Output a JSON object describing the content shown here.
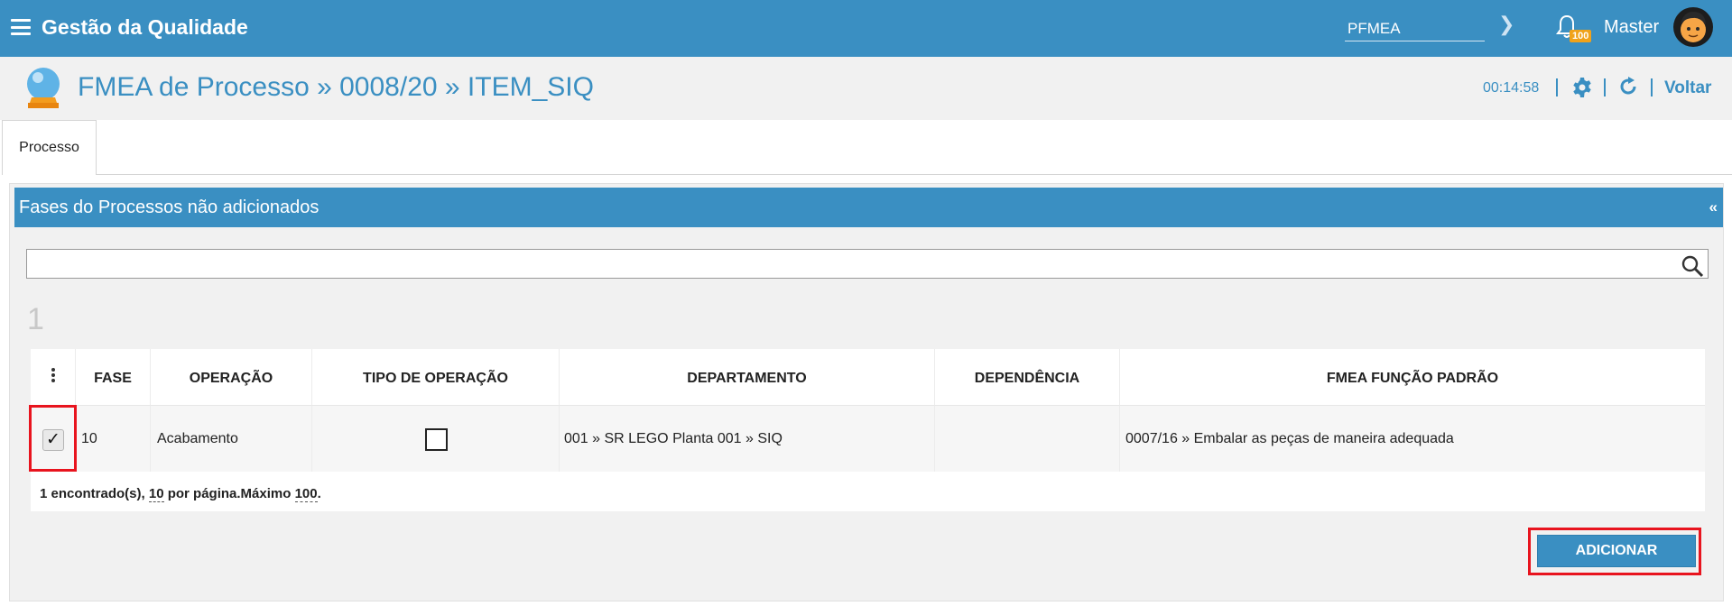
{
  "app": {
    "title": "Gestão da Qualidade"
  },
  "topbar": {
    "module_value": "PFMEA",
    "notifications_count": "100",
    "user_name": "Master"
  },
  "page": {
    "title": "FMEA de Processo » 0008/20 » ITEM_SIQ",
    "timer": "00:14:58",
    "back_label": "Voltar"
  },
  "tabs": [
    {
      "label": "Processo",
      "active": true
    }
  ],
  "panel": {
    "title": "Fases do Processos não adicionados",
    "collapse_glyph": "«",
    "search_value": "",
    "page_number": "1"
  },
  "table": {
    "headers": [
      "FASE",
      "OPERAÇÃO",
      "TIPO DE OPERAÇÃO",
      "DEPARTAMENTO",
      "DEPENDÊNCIA",
      "FMEA FUNÇÃO PADRÃO"
    ],
    "rows": [
      {
        "selected": true,
        "fase": "10",
        "operacao": "Acabamento",
        "tipo_checked": false,
        "departamento": "001 » SR LEGO Planta 001 » SIQ",
        "dependencia": "",
        "funcao": "0007/16 » Embalar as peças de maneira adequada"
      }
    ],
    "footer": {
      "found": "1 encontrado(s), ",
      "per_page": "10",
      "per_page_suffix": " por página.Máximo ",
      "max": "100",
      "end": "."
    }
  },
  "actions": {
    "add_label": "ADICIONAR"
  },
  "colors": {
    "brand": "#3a8fc2",
    "highlight": "#e8141e",
    "badge": "#f0a21a"
  },
  "icons": [
    "menu-icon",
    "chevron-right-icon",
    "bell-icon",
    "avatar",
    "crystal-ball-icon",
    "gear-icon",
    "refresh-icon",
    "search-icon",
    "kebab-menu-icon",
    "check-icon"
  ]
}
